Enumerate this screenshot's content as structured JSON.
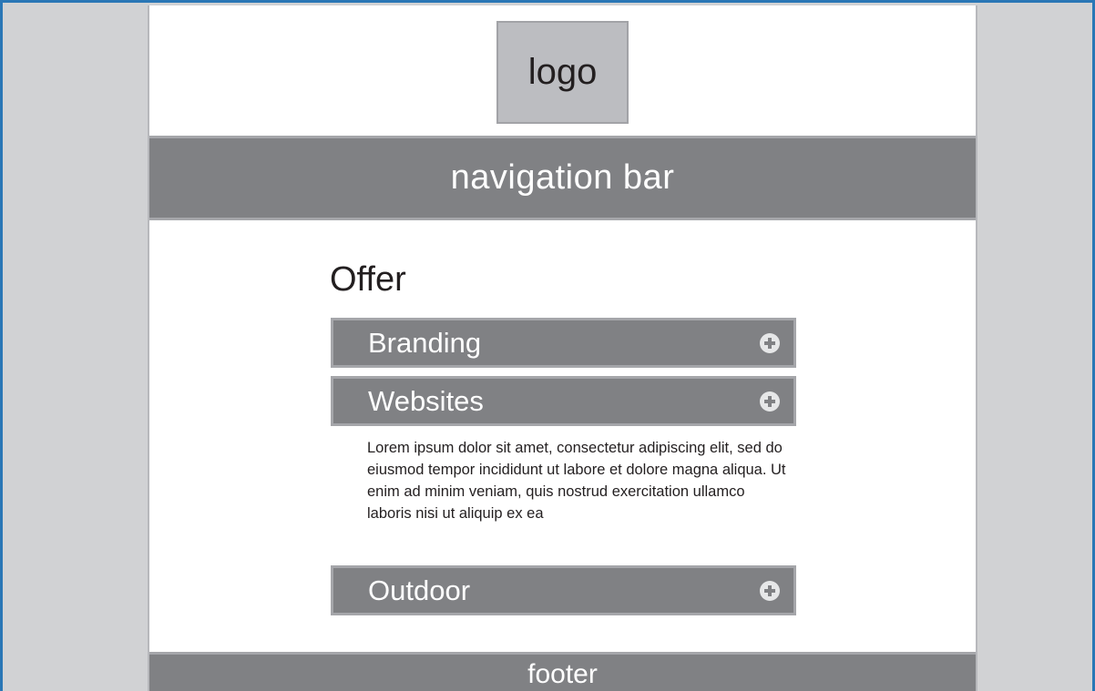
{
  "header": {
    "logo_label": "logo",
    "nav_label": "navigation bar"
  },
  "main": {
    "title": "Offer",
    "accordion": [
      {
        "label": "Branding",
        "icon": "plus-circle-icon",
        "expanded": false
      },
      {
        "label": "Websites",
        "icon": "plus-circle-icon",
        "expanded": true,
        "body": "Lorem ipsum dolor sit amet, consectetur adipiscing elit, sed do eiusmod tempor incididunt ut labore et dolore magna aliqua. Ut enim ad minim veniam, quis nostrud exercitation ullamco laboris nisi ut aliquip ex ea"
      },
      {
        "label": "Outdoor",
        "icon": "plus-circle-icon",
        "expanded": false
      }
    ]
  },
  "footer": {
    "label": "footer"
  },
  "colors": {
    "frame_border": "#2a77b6",
    "side_background": "#d1d2d4",
    "bar_fill": "#808184",
    "bar_border": "#a5a6aa",
    "logo_fill": "#bcbdc1"
  }
}
